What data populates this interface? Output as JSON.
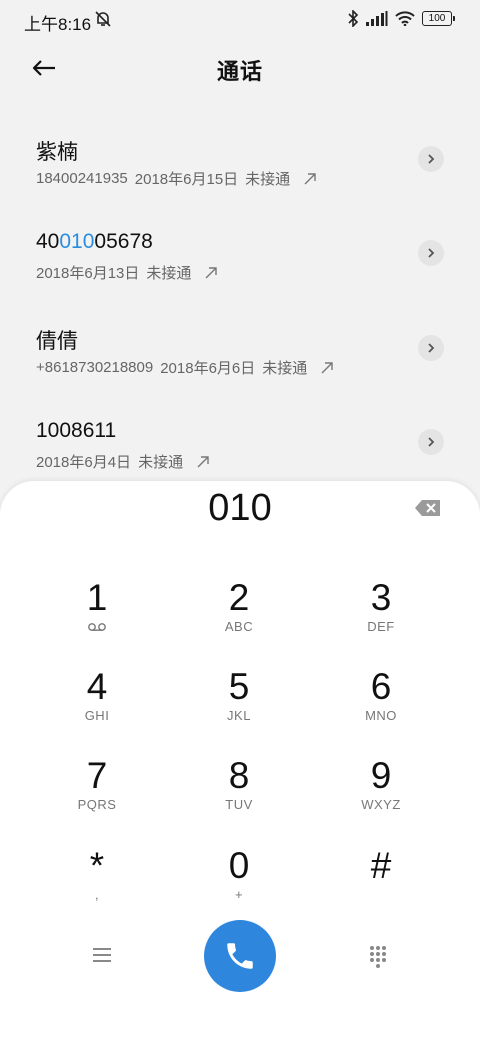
{
  "status_bar": {
    "time": "上午8:16",
    "battery": "100"
  },
  "app_bar": {
    "title": "通话"
  },
  "calls": [
    {
      "name": "紫楠",
      "name_parts": [
        "紫楠",
        "",
        ""
      ],
      "number": "18400241935",
      "date": "2018年6月15日",
      "status": "未接通"
    },
    {
      "name": "4001005678",
      "name_parts": [
        "40",
        "010",
        "05678"
      ],
      "number": "",
      "date": "2018年6月13日",
      "status": "未接通"
    },
    {
      "name": "倩倩",
      "name_parts": [
        "倩倩",
        "",
        ""
      ],
      "number": "+8618730218809",
      "date": "2018年6月6日",
      "status": "未接通"
    },
    {
      "name": "1008611",
      "name_parts": [
        "1008611",
        "",
        ""
      ],
      "number": "",
      "date": "2018年6月4日",
      "status": "未接通"
    }
  ],
  "dialpad": {
    "input": "010",
    "keys": [
      {
        "digit": "1",
        "letters": ""
      },
      {
        "digit": "2",
        "letters": "ABC"
      },
      {
        "digit": "3",
        "letters": "DEF"
      },
      {
        "digit": "4",
        "letters": "GHI"
      },
      {
        "digit": "5",
        "letters": "JKL"
      },
      {
        "digit": "6",
        "letters": "MNO"
      },
      {
        "digit": "7",
        "letters": "PQRS"
      },
      {
        "digit": "8",
        "letters": "TUV"
      },
      {
        "digit": "9",
        "letters": "WXYZ"
      },
      {
        "digit": "*",
        "letters": ","
      },
      {
        "digit": "0",
        "letters": "+"
      },
      {
        "digit": "#",
        "letters": ""
      }
    ]
  },
  "colors": {
    "accent": "#2f87dd",
    "highlight": "#2a8ee0",
    "background": "#f2f2f2"
  },
  "icons": [
    "back-arrow-icon",
    "chevron-right-icon",
    "outgoing-call-icon",
    "backspace-icon",
    "voicemail-icon",
    "menu-icon",
    "phone-icon",
    "dialpad-icon",
    "bluetooth-icon",
    "signal-icon",
    "wifi-icon",
    "alarm-off-icon"
  ]
}
